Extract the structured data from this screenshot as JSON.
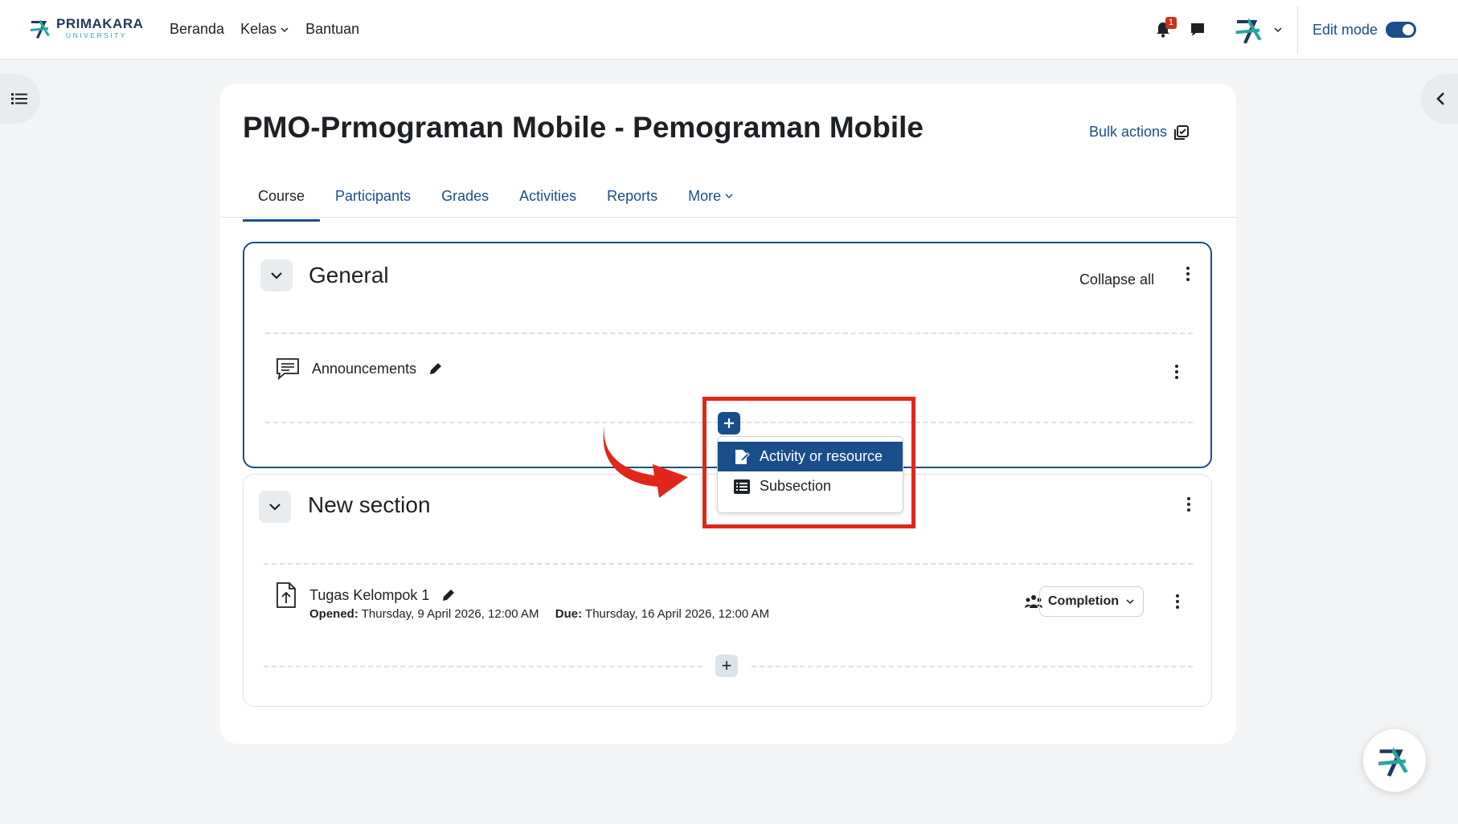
{
  "brand": {
    "name": "PRIMAKARA",
    "subtitle": "UNIVERSITY"
  },
  "nav": {
    "home": "Beranda",
    "classes": "Kelas",
    "help": "Bantuan"
  },
  "notifications": {
    "count": "1"
  },
  "edit_mode": {
    "label": "Edit mode",
    "enabled": true
  },
  "course": {
    "title": "PMO-Prmograman Mobile - Pemograman Mobile",
    "bulk_actions": "Bulk actions"
  },
  "tabs": [
    {
      "label": "Course"
    },
    {
      "label": "Participants"
    },
    {
      "label": "Grades"
    },
    {
      "label": "Activities"
    },
    {
      "label": "Reports"
    },
    {
      "label": "More"
    }
  ],
  "general": {
    "title": "General",
    "collapse_all": "Collapse all",
    "activity": {
      "name": "Announcements"
    }
  },
  "add_menu": {
    "items": [
      {
        "label": "Activity or resource",
        "selected": true
      },
      {
        "label": "Subsection",
        "selected": false
      }
    ]
  },
  "new_section": {
    "title": "New section",
    "activity": {
      "name": "Tugas Kelompok 1",
      "opened_label": "Opened:",
      "opened_value": "Thursday, 9 April 2026, 12:00 AM",
      "due_label": "Due:",
      "due_value": "Thursday, 16 April 2026, 12:00 AM",
      "completion": "Completion"
    }
  },
  "colors": {
    "primary": "#1a4e8a",
    "highlight": "#e1261c",
    "badge": "#ca3120"
  }
}
